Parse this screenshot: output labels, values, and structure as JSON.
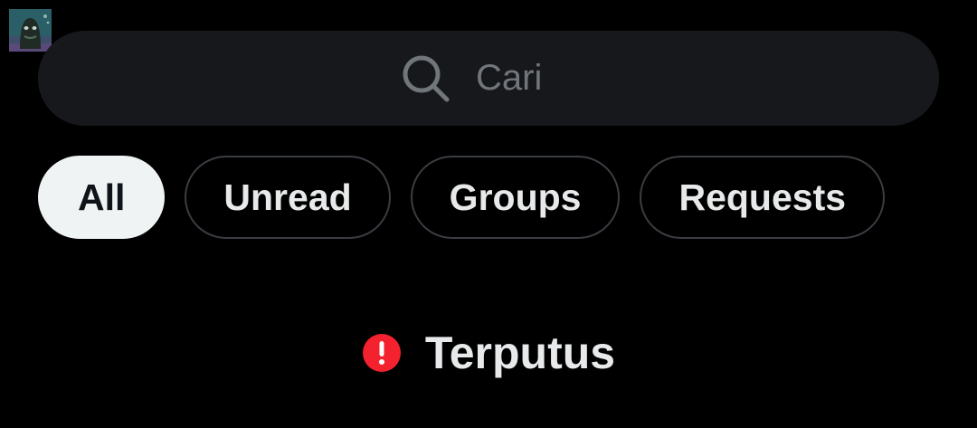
{
  "search": {
    "placeholder": "Cari",
    "value": ""
  },
  "filters": [
    {
      "label": "All",
      "active": true
    },
    {
      "label": "Unread",
      "active": false
    },
    {
      "label": "Groups",
      "active": false
    },
    {
      "label": "Requests",
      "active": false
    }
  ],
  "status": {
    "text": "Terputus",
    "icon": "alert-circle-icon"
  },
  "colors": {
    "background": "#000000",
    "search_bg": "#16181c",
    "pill_border": "#3a3d42",
    "active_pill_bg": "#eff3f4",
    "alert_red": "#f4212e",
    "text_primary": "#e7e9ea",
    "text_muted": "#71767b"
  }
}
